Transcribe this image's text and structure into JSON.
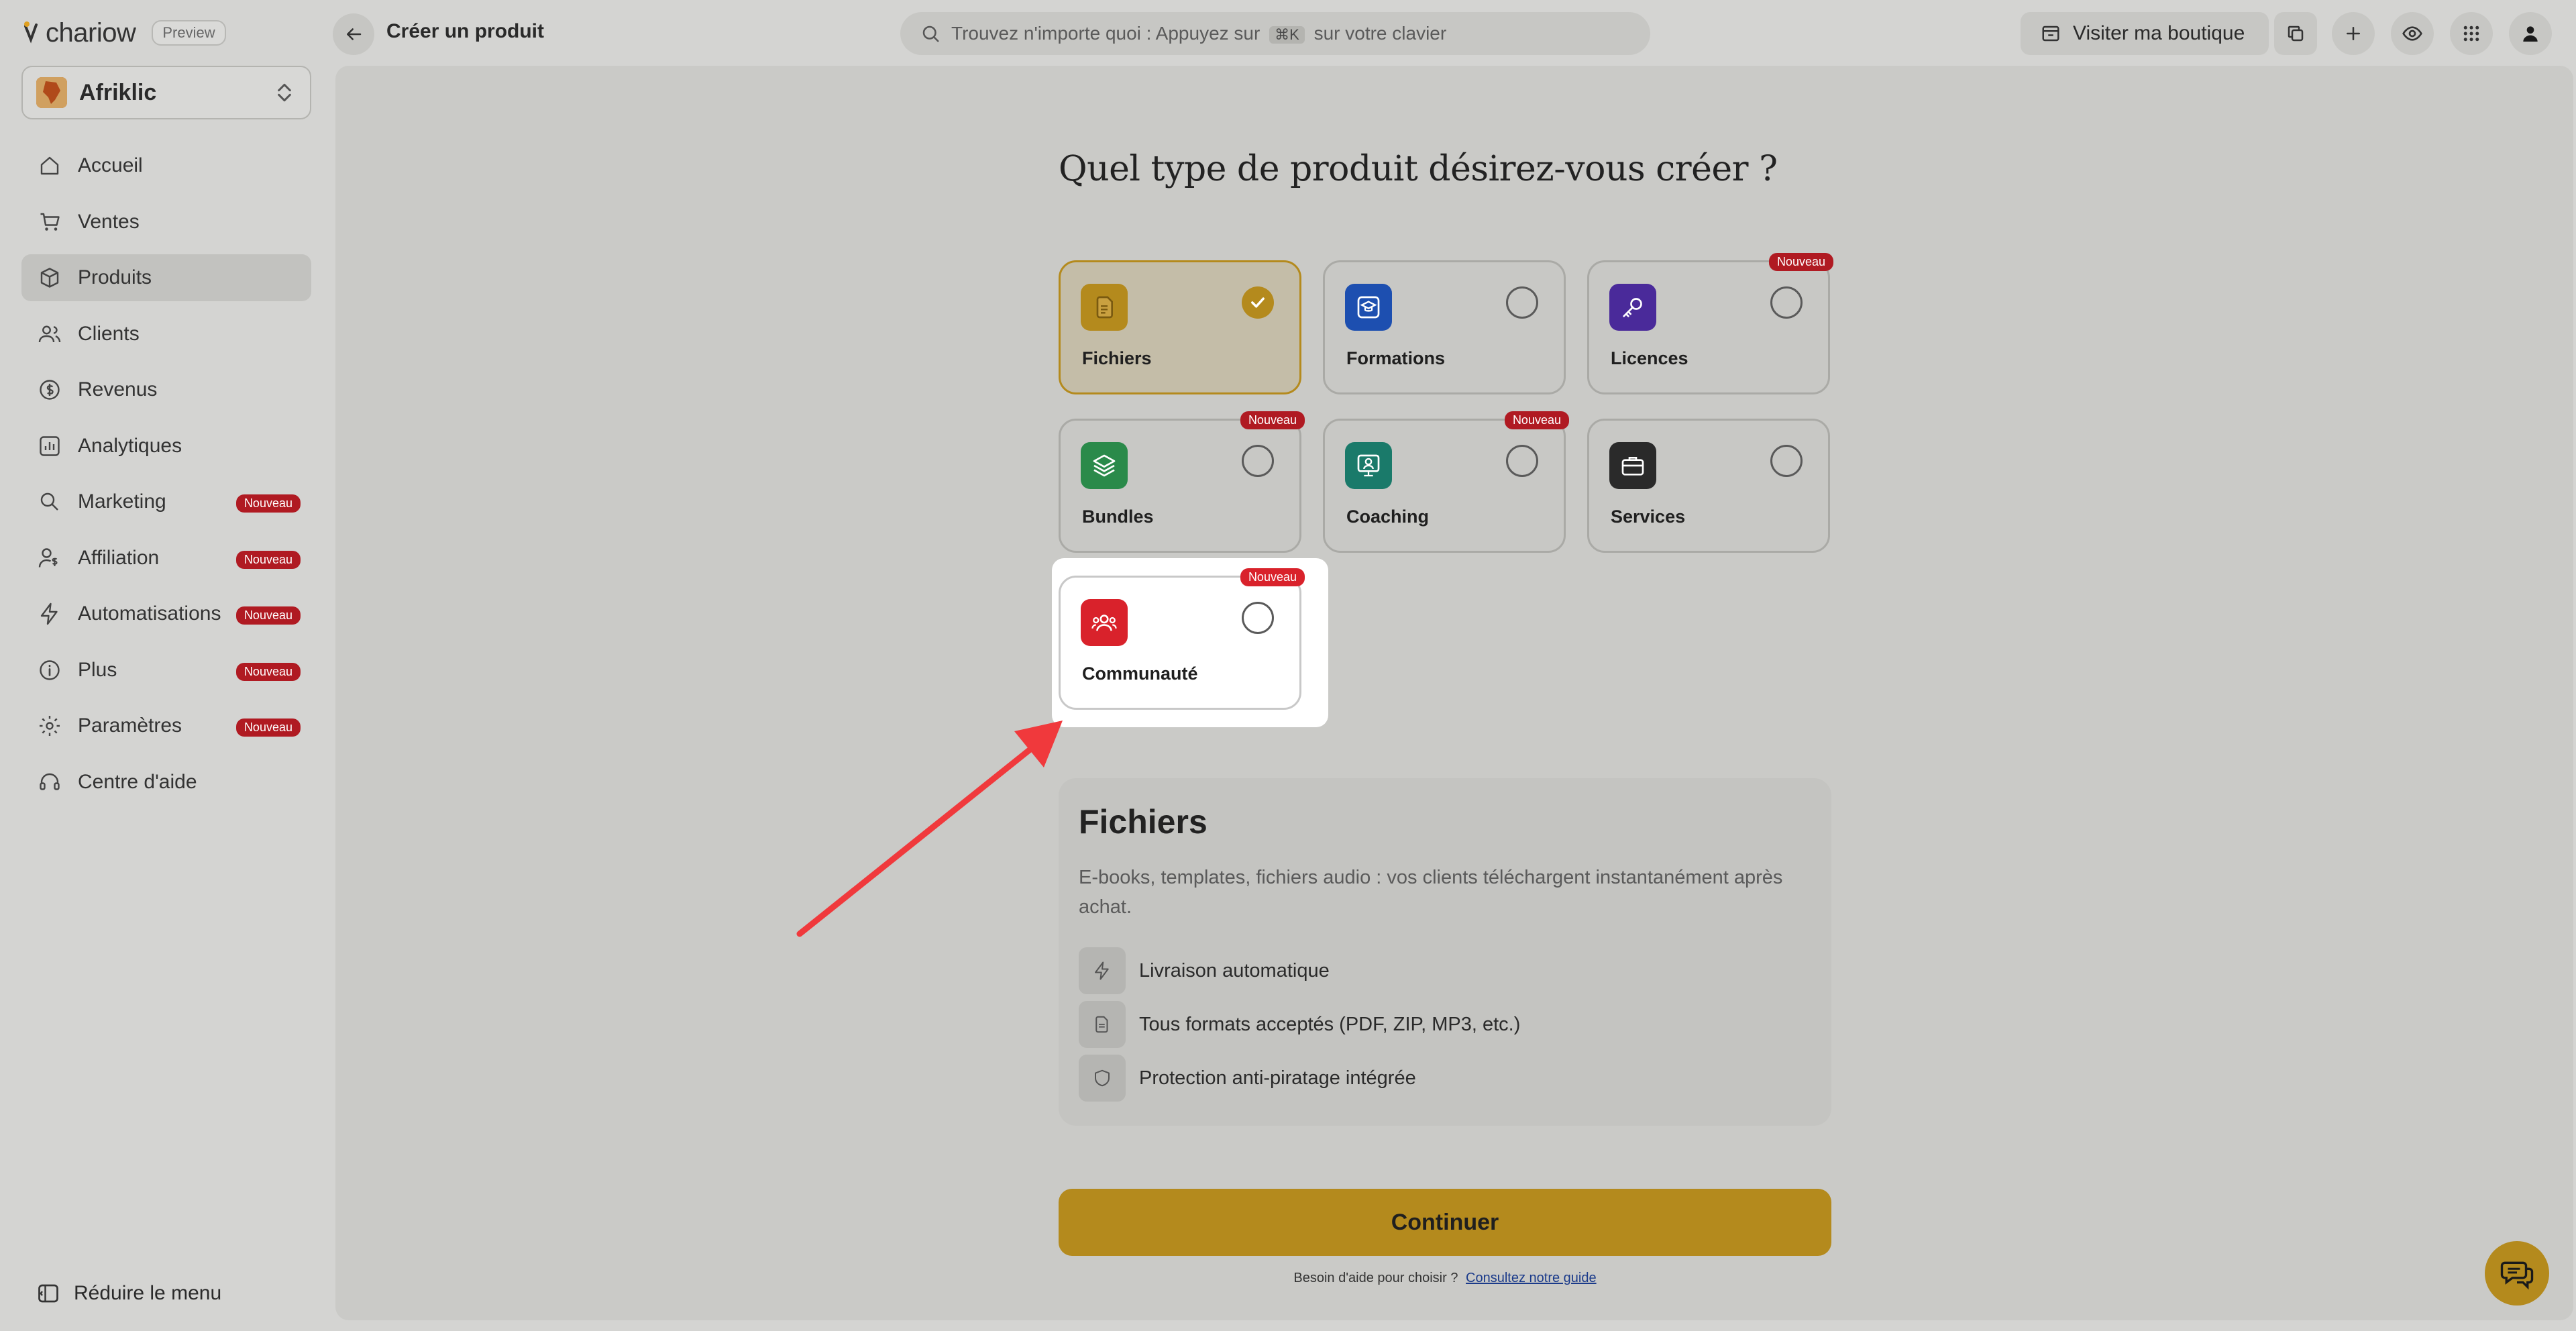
{
  "app": {
    "logo_text": "chariow",
    "preview_label": "Preview"
  },
  "header": {
    "page_title": "Créer un produit",
    "search": {
      "text_before": "Trouvez n'importe quoi : Appuyez sur",
      "shortcut": "⌘K",
      "text_after": "sur votre clavier"
    },
    "visit_store_label": "Visiter ma boutique"
  },
  "sidebar": {
    "store_name": "Afriklic",
    "items": [
      {
        "label": "Accueil",
        "badge": ""
      },
      {
        "label": "Ventes",
        "badge": ""
      },
      {
        "label": "Produits",
        "badge": ""
      },
      {
        "label": "Clients",
        "badge": ""
      },
      {
        "label": "Revenus",
        "badge": ""
      },
      {
        "label": "Analytiques",
        "badge": ""
      },
      {
        "label": "Marketing",
        "badge": "Nouveau"
      },
      {
        "label": "Affiliation",
        "badge": "Nouveau"
      },
      {
        "label": "Automatisations",
        "badge": "Nouveau"
      },
      {
        "label": "Plus",
        "badge": "Nouveau"
      },
      {
        "label": "Paramètres",
        "badge": "Nouveau"
      },
      {
        "label": "Centre d'aide",
        "badge": ""
      }
    ],
    "reduce_label": "Réduire le menu"
  },
  "main": {
    "question": "Quel type de produit désirez-vous créer ?",
    "product_types": [
      {
        "label": "Fichiers",
        "badge": "",
        "selected": true,
        "color": "#b48a1d"
      },
      {
        "label": "Formations",
        "badge": "",
        "selected": false,
        "color": "#1d4fb0"
      },
      {
        "label": "Licences",
        "badge": "Nouveau",
        "selected": false,
        "color": "#4a2a9a"
      },
      {
        "label": "Bundles",
        "badge": "Nouveau",
        "selected": false,
        "color": "#2a8a4a"
      },
      {
        "label": "Coaching",
        "badge": "Nouveau",
        "selected": false,
        "color": "#1a7a6a"
      },
      {
        "label": "Services",
        "badge": "",
        "selected": false,
        "color": "#2a2a2a"
      },
      {
        "label": "Communauté",
        "badge": "Nouveau",
        "selected": false,
        "color": "#d9222b"
      }
    ],
    "info": {
      "title": "Fichiers",
      "description": "E-books, templates, fichiers audio : vos clients téléchargent instantanément après achat.",
      "features": [
        "Livraison automatique",
        "Tous formats acceptés (PDF, ZIP, MP3, etc.)",
        "Protection anti-piratage intégrée"
      ]
    },
    "continue_label": "Continuer",
    "help_text": "Besoin d'aide pour choisir ?",
    "help_link": "Consultez notre guide"
  }
}
